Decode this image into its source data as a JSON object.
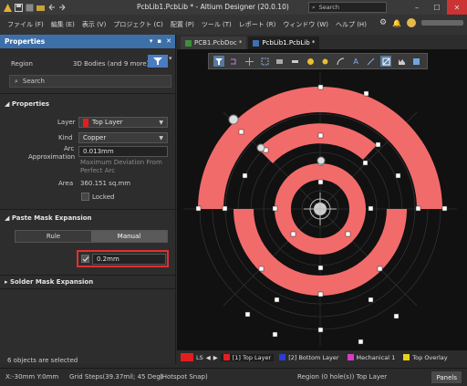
{
  "window": {
    "title": "PcbLib1.PcbLib * - Altium Designer (20.0.10)",
    "search_placeholder": "Search"
  },
  "menu": {
    "items": [
      "ファイル (F)",
      "編集 (E)",
      "表示 (V)",
      "プロジェクト (C)",
      "配置 (P)",
      "ツール (T)",
      "レポート (R)",
      "ウィンドウ (W)",
      "ヘルプ (H)"
    ]
  },
  "panel": {
    "title": "Properties",
    "region_label": "Region",
    "region_value": "3D Bodies (and 9 more)",
    "search_placeholder": "Search",
    "properties_section": "Properties",
    "layer_label": "Layer",
    "layer_value": "Top Layer",
    "kind_label": "Kind",
    "kind_value": "Copper",
    "arc_label_1": "Arc",
    "arc_label_2": "Approximation",
    "arc_value": "0.013mm",
    "max_dev_line1": "Maximum Deviation From",
    "max_dev_line2": "Perfect Arc",
    "area_label": "Area",
    "area_value": "360.151 sq.mm",
    "locked_label": "Locked",
    "paste_section": "Paste Mask Expansion",
    "rule_label": "Rule",
    "manual_label": "Manual",
    "expansion_value": "0.2mm",
    "solder_section": "Solder Mask Expansion",
    "selection_status": "6 objects are selected"
  },
  "tabs": [
    {
      "label": "PCB1.PcbDoc *"
    },
    {
      "label": "PcbLib1.PcbLib *"
    }
  ],
  "layers": {
    "ls_label": "LS",
    "items": [
      {
        "label": "[1] Top Layer",
        "color": "#e31e1e"
      },
      {
        "label": "[2] Bottom Layer",
        "color": "#2a3cd6"
      },
      {
        "label": "Mechanical 1",
        "color": "#d63cc8"
      },
      {
        "label": "Top Overlay",
        "color": "#e6d21e"
      }
    ]
  },
  "status": {
    "coords": "X:-30mm Y:0mm",
    "grid": "Grid Steps(39.37mil; 45 Deg)",
    "snap": "(Hotspot Snap)",
    "region": "Region (0 hole(s)) Top Layer",
    "panels_button": "Panels"
  },
  "colors": {
    "copper": "#f26b6b",
    "panel_header": "#3d6fa8",
    "highlight": "#e03030"
  }
}
